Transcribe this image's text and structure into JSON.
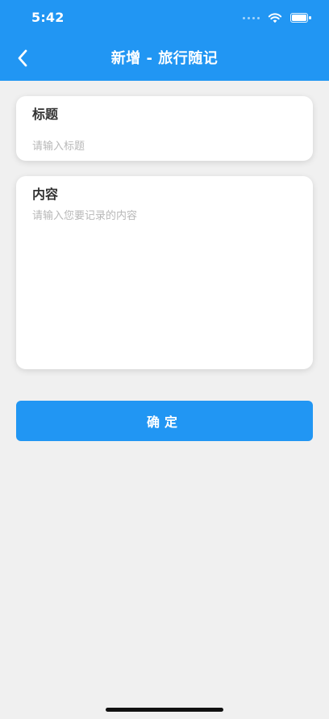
{
  "status_bar": {
    "time": "5:42"
  },
  "nav": {
    "title": "新增 - 旅行随记",
    "back_icon": "chevron-left-icon"
  },
  "form": {
    "title_field": {
      "label": "标题",
      "placeholder": "请输入标题",
      "value": ""
    },
    "content_field": {
      "label": "内容",
      "placeholder": "请输入您要记录的内容",
      "value": ""
    }
  },
  "actions": {
    "confirm_label": "确定"
  },
  "colors": {
    "primary": "#2196f3",
    "background": "#f0f0f0",
    "card": "#ffffff",
    "label": "#333333",
    "placeholder": "#b8b8b8"
  }
}
